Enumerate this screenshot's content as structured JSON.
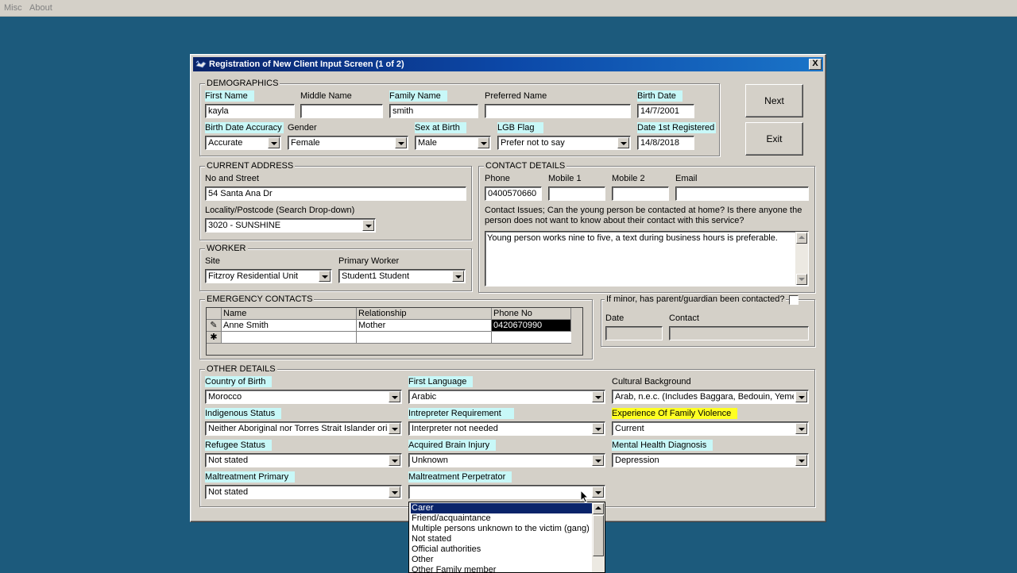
{
  "menubar": {
    "items": [
      "Misc",
      "About"
    ]
  },
  "window": {
    "title": "Registration of New Client Input Screen (1 of 2)",
    "close_label": "X"
  },
  "buttons": {
    "next": "Next",
    "exit": "Exit"
  },
  "demographics": {
    "title": "DEMOGRAPHICS",
    "first_name": {
      "label": "First Name",
      "value": "kayla"
    },
    "middle_name": {
      "label": "Middle Name",
      "value": ""
    },
    "family_name": {
      "label": "Family Name",
      "value": "smith"
    },
    "preferred_name": {
      "label": "Preferred Name",
      "value": ""
    },
    "birth_date": {
      "label": "Birth Date",
      "value": "14/7/2001"
    },
    "birth_date_accuracy": {
      "label": "Birth Date Accuracy",
      "value": "Accurate"
    },
    "gender": {
      "label": "Gender",
      "value": "Female"
    },
    "sex_at_birth": {
      "label": "Sex at Birth",
      "value": "Male"
    },
    "lgb_flag": {
      "label": "LGB Flag",
      "value": "Prefer not to say"
    },
    "date_first_registered": {
      "label": "Date 1st Registered",
      "value": "14/8/2018"
    }
  },
  "address": {
    "title": "CURRENT ADDRESS",
    "street": {
      "label": "No and Street",
      "value": "54 Santa Ana Dr"
    },
    "locality": {
      "label": "Locality/Postcode (Search Drop-down)",
      "value": "3020 - SUNSHINE"
    }
  },
  "worker": {
    "title": "WORKER",
    "site": {
      "label": "Site",
      "value": "Fitzroy Residential Unit"
    },
    "primary_worker": {
      "label": "Primary Worker",
      "value": "Student1 Student"
    }
  },
  "contact": {
    "title": "CONTACT DETAILS",
    "phone": {
      "label": "Phone",
      "value": "0400570660"
    },
    "mobile1": {
      "label": "Mobile 1",
      "value": ""
    },
    "mobile2": {
      "label": "Mobile 2",
      "value": ""
    },
    "email": {
      "label": "Email",
      "value": ""
    },
    "issues_label_line1": "Contact Issues; Can the young person be contacted at home? Is there anyone the",
    "issues_label_line2": "person does not want to know about their contact with this service?",
    "issues_value": "Young person works nine to five, a text during business hours is preferable."
  },
  "emergency": {
    "title": "EMERGENCY CONTACTS",
    "columns": [
      "Name",
      "Relationship",
      "Phone No"
    ],
    "rows": [
      {
        "name": "Anne Smith",
        "relationship": "Mother",
        "phone": "0420670990"
      }
    ],
    "edit_glyph": "✎",
    "new_row_glyph": "✱"
  },
  "guardian": {
    "title": "If minor, has parent/guardian been contacted?",
    "checked": false,
    "date_label": "Date",
    "contact_label": "Contact",
    "date_value": "",
    "contact_value": ""
  },
  "other": {
    "title": "OTHER DETAILS",
    "country_of_birth": {
      "label": "Country of Birth",
      "value": "Morocco"
    },
    "first_language": {
      "label": "First Language",
      "value": "Arabic"
    },
    "cultural_background": {
      "label": "Cultural Background",
      "value": "Arab, n.e.c. (Includes Baggara, Bedouin, Yemeni)"
    },
    "indigenous_status": {
      "label": "Indigenous Status",
      "value": "Neither Aboriginal nor Torres Strait Islander origin"
    },
    "interpreter": {
      "label": "Intrepreter Requirement",
      "value": "Interpreter not needed"
    },
    "family_violence": {
      "label": "Experience Of Family Violence",
      "value": "Current"
    },
    "refugee_status": {
      "label": "Refugee Status",
      "value": "Not stated"
    },
    "brain_injury": {
      "label": "Acquired Brain Injury",
      "value": "Unknown"
    },
    "mental_health": {
      "label": "Mental Health Diagnosis",
      "value": "Depression"
    },
    "maltreatment_primary": {
      "label": "Maltreatment Primary",
      "value": "Not stated"
    },
    "maltreatment_perpetrator": {
      "label": "Maltreatment Perpetrator",
      "value": "",
      "options": [
        "Carer",
        "Friend/acquaintance",
        "Multiple persons unknown to the victim (gang)",
        "Not stated",
        "Official authorities",
        "Other",
        "Other Family member"
      ],
      "highlighted": "Carer"
    }
  },
  "colors": {
    "desktop": "#1c5a7c",
    "required_label_bg": "#c8f8f8",
    "warning_label_bg": "#ffff22",
    "selection": "#0a246a"
  }
}
